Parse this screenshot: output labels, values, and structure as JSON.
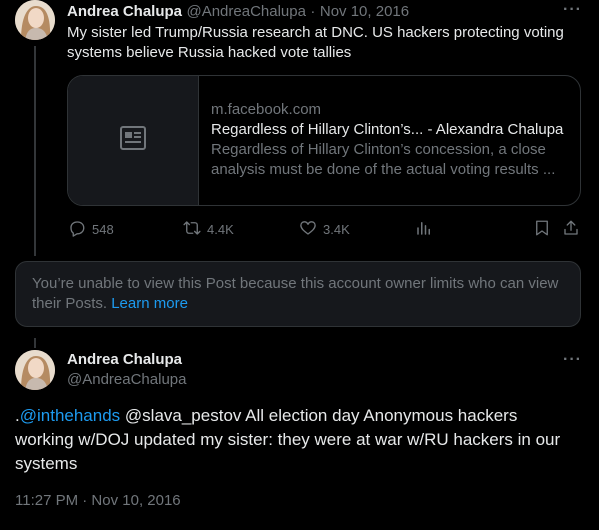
{
  "tweet1": {
    "name": "Andrea Chalupa",
    "handle": "@AndreaChalupa",
    "separator": "·",
    "date": "Nov 10, 2016",
    "more": "···",
    "text_line1": "My sister led Trump/Russia research at DNC. US hackers protecting voting",
    "text_line2": "systems believe Russia hacked vote tallies",
    "card": {
      "domain": "m.facebook.com",
      "title": "Regardless of Hillary Clinton’s... - Alexandra Chalupa",
      "desc_line1": "Regardless of Hillary Clinton’s concession, a close",
      "desc_line2": "analysis must be done of the actual voting results ...",
      "thumb_icon": "article-icon"
    },
    "actions": {
      "replies": "548",
      "reposts": "4.4K",
      "likes": "3.4K"
    }
  },
  "notice": {
    "text": "You’re unable to view this Post because this account owner limits who can view their Posts.",
    "link": "Learn more"
  },
  "tweet2": {
    "name": "Andrea Chalupa",
    "handle": "@AndreaChalupa",
    "more": "···",
    "mention1": "@inthehands",
    "line1_prefix": ".",
    "line1_rest": " @slava_pestov All election day Anonymous hackers",
    "line2": "working w/DOJ updated my sister: they were at war w/RU hackers in our",
    "line3": "systems",
    "time": "11:27 PM · Nov 10, 2016"
  },
  "colors": {
    "background": "#000000",
    "text": "#e7e9ea",
    "muted": "#71767b",
    "link": "#1d9bf0",
    "border": "#2f3336"
  }
}
